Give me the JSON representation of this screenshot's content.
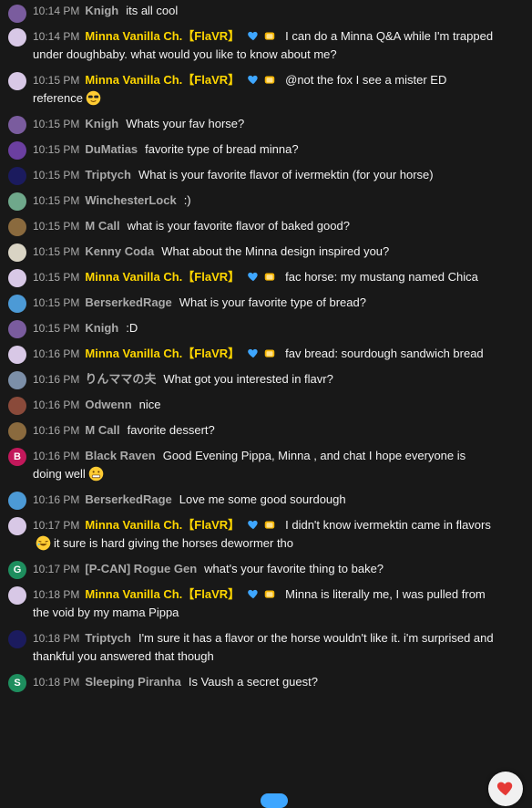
{
  "messages": [
    {
      "time": "10:14 PM",
      "author": "Knigh",
      "owner": false,
      "text": "its all cool",
      "avatar": "#7a5c9e"
    },
    {
      "time": "10:14 PM",
      "author": "Minna Vanilla Ch.【FlaVR】",
      "owner": true,
      "text": "I can do a Minna Q&A while I'm trapped under doughbaby. what would you like to know about me?",
      "avatar": "#d8c8e6"
    },
    {
      "time": "10:15 PM",
      "author": "Minna Vanilla Ch.【FlaVR】",
      "owner": true,
      "text": "@not the fox I see a mister ED reference",
      "emoji": "sunglasses",
      "avatar": "#d8c8e6"
    },
    {
      "time": "10:15 PM",
      "author": "Knigh",
      "owner": false,
      "text": "Whats your fav horse?",
      "avatar": "#7a5c9e"
    },
    {
      "time": "10:15 PM",
      "author": "DuMatias",
      "owner": false,
      "text": "favorite type of bread minna?",
      "avatar": "#6b3fa0"
    },
    {
      "time": "10:15 PM",
      "author": "Triptych",
      "owner": false,
      "text": "What is your favorite flavor of ivermektin (for your horse)",
      "avatar": "#1b1b5e"
    },
    {
      "time": "10:15 PM",
      "author": "WinchesterLock",
      "owner": false,
      "text": ":)",
      "avatar": "#6fa88b"
    },
    {
      "time": "10:15 PM",
      "author": "M Call",
      "owner": false,
      "text": "what is your favorite flavor of baked good?",
      "avatar": "#8a6a3e"
    },
    {
      "time": "10:15 PM",
      "author": "Kenny Coda",
      "owner": false,
      "text": "What about the Minna design inspired you?",
      "avatar": "#d9d4c4"
    },
    {
      "time": "10:15 PM",
      "author": "Minna Vanilla Ch.【FlaVR】",
      "owner": true,
      "text": "fac horse: my mustang named Chica",
      "avatar": "#d8c8e6"
    },
    {
      "time": "10:15 PM",
      "author": "BerserkedRage",
      "owner": false,
      "text": "What is your favorite type of bread?",
      "avatar": "#4c9ad6"
    },
    {
      "time": "10:15 PM",
      "author": "Knigh",
      "owner": false,
      "text": ":D",
      "avatar": "#7a5c9e"
    },
    {
      "time": "10:16 PM",
      "author": "Minna Vanilla Ch.【FlaVR】",
      "owner": true,
      "text": "fav bread: sourdough sandwich bread",
      "avatar": "#d8c8e6"
    },
    {
      "time": "10:16 PM",
      "author": "りんママの夫",
      "owner": false,
      "text": "What got you interested in flavr?",
      "avatar": "#7c8fa8"
    },
    {
      "time": "10:16 PM",
      "author": "Odwenn",
      "owner": false,
      "text": "nice",
      "avatar": "#8a4a3a"
    },
    {
      "time": "10:16 PM",
      "author": "M Call",
      "owner": false,
      "text": "favorite dessert?",
      "avatar": "#8a6a3e"
    },
    {
      "time": "10:16 PM",
      "author": "Black Raven",
      "owner": false,
      "text": "Good Evening Pippa, Minna , and chat I hope everyone is doing well",
      "emoji": "grimace",
      "avatar": "#c2185b",
      "initial": "B"
    },
    {
      "time": "10:16 PM",
      "author": "BerserkedRage",
      "owner": false,
      "text": "Love me some good sourdough",
      "avatar": "#4c9ad6"
    },
    {
      "time": "10:17 PM",
      "author": "Minna Vanilla Ch.【FlaVR】",
      "owner": true,
      "text": "I didn't know ivermektin came in flavors",
      "emoji2": "rofl",
      "text2": "it sure is hard giving the horses dewormer tho",
      "avatar": "#d8c8e6"
    },
    {
      "time": "10:17 PM",
      "author": "[P-CAN] Rogue Gen",
      "owner": false,
      "text": "what's your favorite thing to bake?",
      "avatar": "#1e8e5e",
      "initial": "G"
    },
    {
      "time": "10:18 PM",
      "author": "Minna Vanilla Ch.【FlaVR】",
      "owner": true,
      "text": "Minna is literally me, I was pulled from the void by my mama Pippa",
      "avatar": "#d8c8e6"
    },
    {
      "time": "10:18 PM",
      "author": "Triptych",
      "owner": false,
      "text": "I'm sure it has a flavor or the horse wouldn't like it. i'm surprised and thankful you answered that though",
      "avatar": "#1b1b5e"
    },
    {
      "time": "10:18 PM",
      "author": "Sleeping Piranha",
      "owner": false,
      "text": "Is Vaush a secret guest?",
      "avatar": "#1e8e5e",
      "initial": "S"
    }
  ],
  "colors": {
    "owner": "#ffd600",
    "member": "#aaaaaa",
    "background": "#181818",
    "heart": "#e53935"
  },
  "icons": {
    "badge_heart": "blue-heart-icon",
    "badge_bread": "bread-icon",
    "reaction": "heart-reaction-icon"
  }
}
